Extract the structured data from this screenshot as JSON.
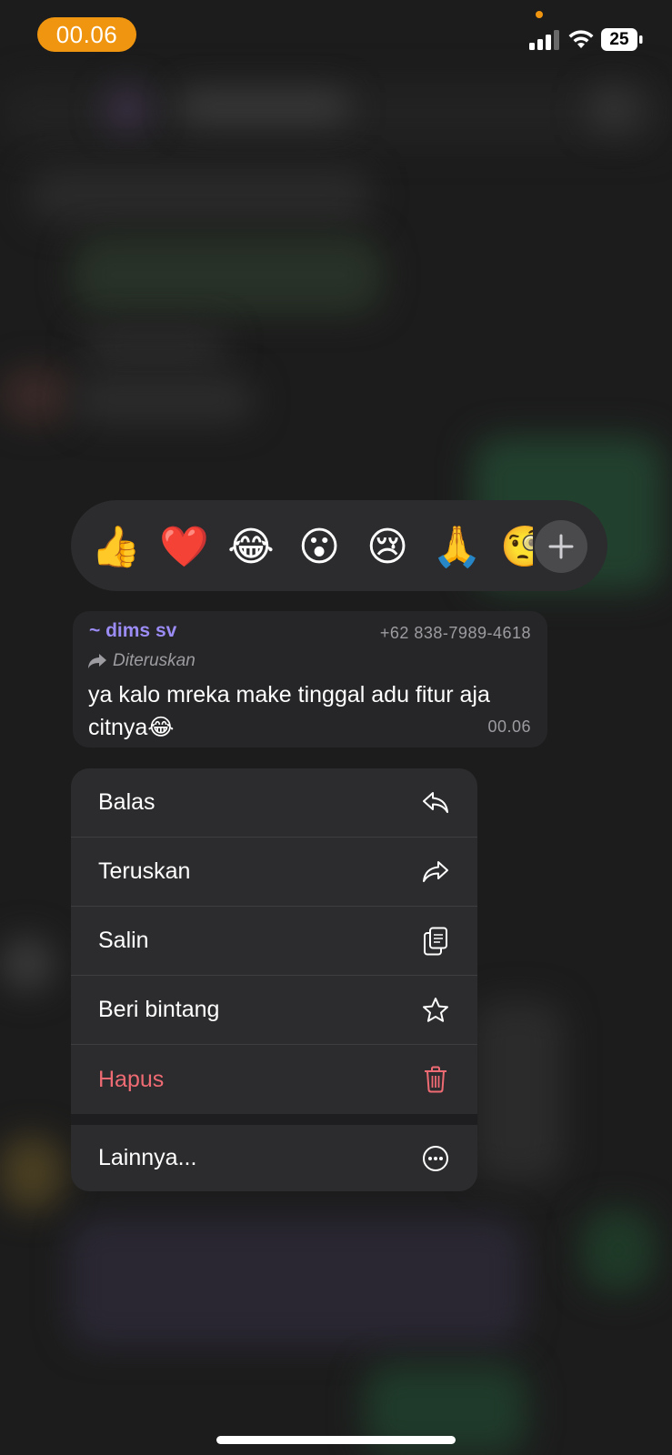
{
  "status_bar": {
    "time": "00.06",
    "battery": "25"
  },
  "reactions": {
    "emojis": [
      "👍",
      "❤️",
      "😂",
      "😮",
      "😢",
      "🙏",
      "🧐"
    ],
    "more_label": "+"
  },
  "message": {
    "sender": "~ dims sv",
    "phone": "+62 838-7989-4618",
    "forwarded_label": "Diteruskan",
    "text": "ya kalo mreka make tinggal adu fitur aja citnya😂",
    "time": "00.06"
  },
  "menu": {
    "items": [
      {
        "label": "Balas",
        "icon": "reply-icon"
      },
      {
        "label": "Teruskan",
        "icon": "forward-icon"
      },
      {
        "label": "Salin",
        "icon": "copy-icon"
      },
      {
        "label": "Beri bintang",
        "icon": "star-icon"
      },
      {
        "label": "Hapus",
        "icon": "trash-icon"
      },
      {
        "label": "Lainnya...",
        "icon": "more-icon"
      }
    ]
  },
  "colors": {
    "accent_orange": "#f0950f",
    "sender_purple": "#9b8cf5",
    "danger_red": "#ef6b73",
    "menu_bg": "#2c2c2e"
  }
}
